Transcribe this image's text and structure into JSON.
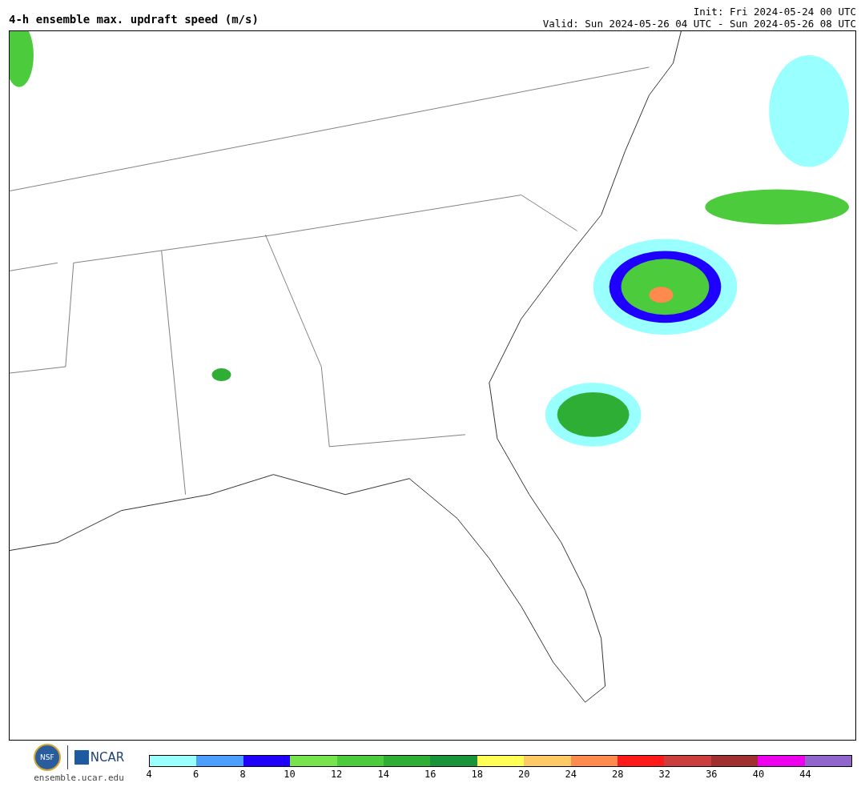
{
  "title": "4-h ensemble max. updraft speed (m/s)",
  "init": "Init: Fri 2024-05-24 00 UTC",
  "valid": "Valid: Sun 2024-05-26 04 UTC - Sun 2024-05-26 08 UTC",
  "logos": {
    "nsf": "NSF",
    "ncar": "NCAR",
    "url": "ensemble.ucar.edu"
  },
  "legend": [
    {
      "label": "4",
      "color": "#99ffff"
    },
    {
      "label": "6",
      "color": "#4d9fff"
    },
    {
      "label": "8",
      "color": "#1f00ff"
    },
    {
      "label": "10",
      "color": "#77e34d"
    },
    {
      "label": "12",
      "color": "#4ccc3c"
    },
    {
      "label": "14",
      "color": "#2fae35"
    },
    {
      "label": "16",
      "color": "#1a9438"
    },
    {
      "label": "18",
      "color": "#ffff55"
    },
    {
      "label": "20",
      "color": "#ffc966"
    },
    {
      "label": "24",
      "color": "#ff8a4d"
    },
    {
      "label": "28",
      "color": "#ff1a1a"
    },
    {
      "label": "32",
      "color": "#cc3d3d"
    },
    {
      "label": "36",
      "color": "#a02f2f"
    },
    {
      "label": "40",
      "color": "#ee00ee"
    },
    {
      "label": "44",
      "color": "#9066cc"
    }
  ]
}
